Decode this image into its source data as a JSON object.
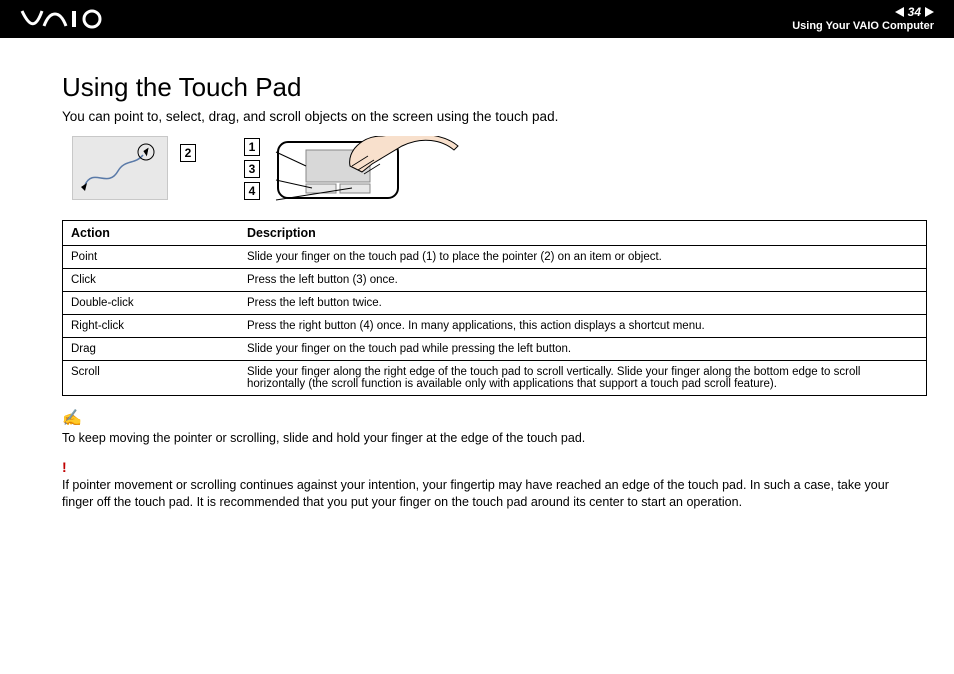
{
  "header": {
    "page_number": "34",
    "section": "Using Your VAIO Computer"
  },
  "title": "Using the Touch Pad",
  "intro": "You can point to, select, drag, and scroll objects on the screen using the touch pad.",
  "labels": {
    "n1": "1",
    "n2": "2",
    "n3": "3",
    "n4": "4"
  },
  "table": {
    "head_action": "Action",
    "head_desc": "Description",
    "rows": [
      {
        "action": "Point",
        "desc": "Slide your finger on the touch pad (1) to place the pointer (2) on an item or object."
      },
      {
        "action": "Click",
        "desc": "Press the left button (3) once."
      },
      {
        "action": "Double-click",
        "desc": "Press the left button twice."
      },
      {
        "action": "Right-click",
        "desc": "Press the right button (4) once. In many applications, this action displays a shortcut menu."
      },
      {
        "action": "Drag",
        "desc": "Slide your finger on the touch pad while pressing the left button."
      },
      {
        "action": "Scroll",
        "desc": "Slide your finger along the right edge of the touch pad to scroll vertically. Slide your finger along the bottom edge to scroll horizontally (the scroll function is available only with applications that support a touch pad scroll feature)."
      }
    ]
  },
  "note_text": "To keep moving the pointer or scrolling, slide and hold your finger at the edge of the touch pad.",
  "warn_text": "If pointer movement or scrolling continues against your intention, your fingertip may have reached an edge of the touch pad. In such a case, take your finger off the touch pad. It is recommended that you put your finger on the touch pad around its center to start an operation."
}
